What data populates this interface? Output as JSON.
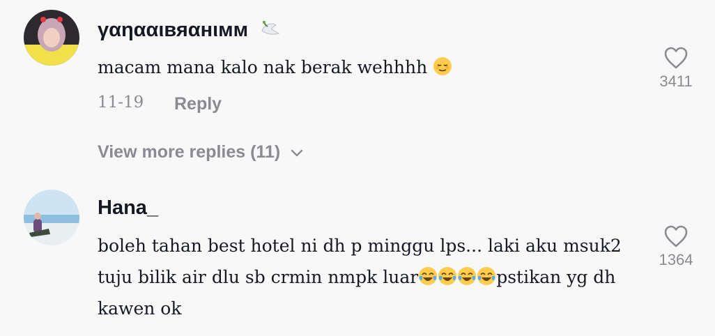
{
  "comments": [
    {
      "username": "γαηααιвяαнιмм",
      "badge_icon": "dove-icon",
      "text": "macam mana kalo nak berak wehhhh",
      "emoji": "relieved-face-emoji",
      "date": "11-19",
      "reply_label": "Reply",
      "likes": "3411",
      "view_more_label": "View more replies (11)"
    },
    {
      "username": "Hana_",
      "text_part1": "boleh tahan best hotel ni dh p minggu lps... laki aku msuk2 tuju bilik air dlu sb crmin nmpk luar",
      "emoji": "tears-of-joy-emoji",
      "text_part2": "pstikan yg dh kawen ok",
      "likes": "1364"
    }
  ]
}
